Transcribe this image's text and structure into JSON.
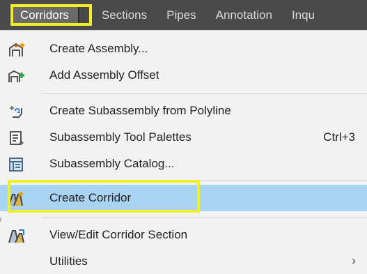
{
  "menubar": {
    "items": [
      {
        "label": "Corridors",
        "active": true
      },
      {
        "label": "Sections"
      },
      {
        "label": "Pipes"
      },
      {
        "label": "Annotation"
      },
      {
        "label": "Inqu"
      }
    ]
  },
  "menu": {
    "items": [
      {
        "label": "Create Assembly...",
        "icon": "assembly-icon"
      },
      {
        "label": "Add Assembly Offset",
        "icon": "assembly-offset-icon"
      },
      {
        "label": "Create Subassembly from Polyline",
        "icon": "subassembly-polyline-icon"
      },
      {
        "label": "Subassembly Tool Palettes",
        "icon": "tool-palettes-icon",
        "shortcut": "Ctrl+3"
      },
      {
        "label": "Subassembly Catalog...",
        "icon": "catalog-icon"
      },
      {
        "label": "Create Corridor",
        "icon": "corridor-icon",
        "selected": true
      },
      {
        "label": "View/Edit Corridor Section",
        "icon": "corridor-section-icon"
      },
      {
        "label": "Utilities",
        "submenu": true
      }
    ]
  },
  "colors": {
    "menubar_background": "#4a4a4a",
    "menu_background": "#f2f2f2",
    "selected_background": "#a8d3f1",
    "highlight_outline": "#f2ef28"
  }
}
